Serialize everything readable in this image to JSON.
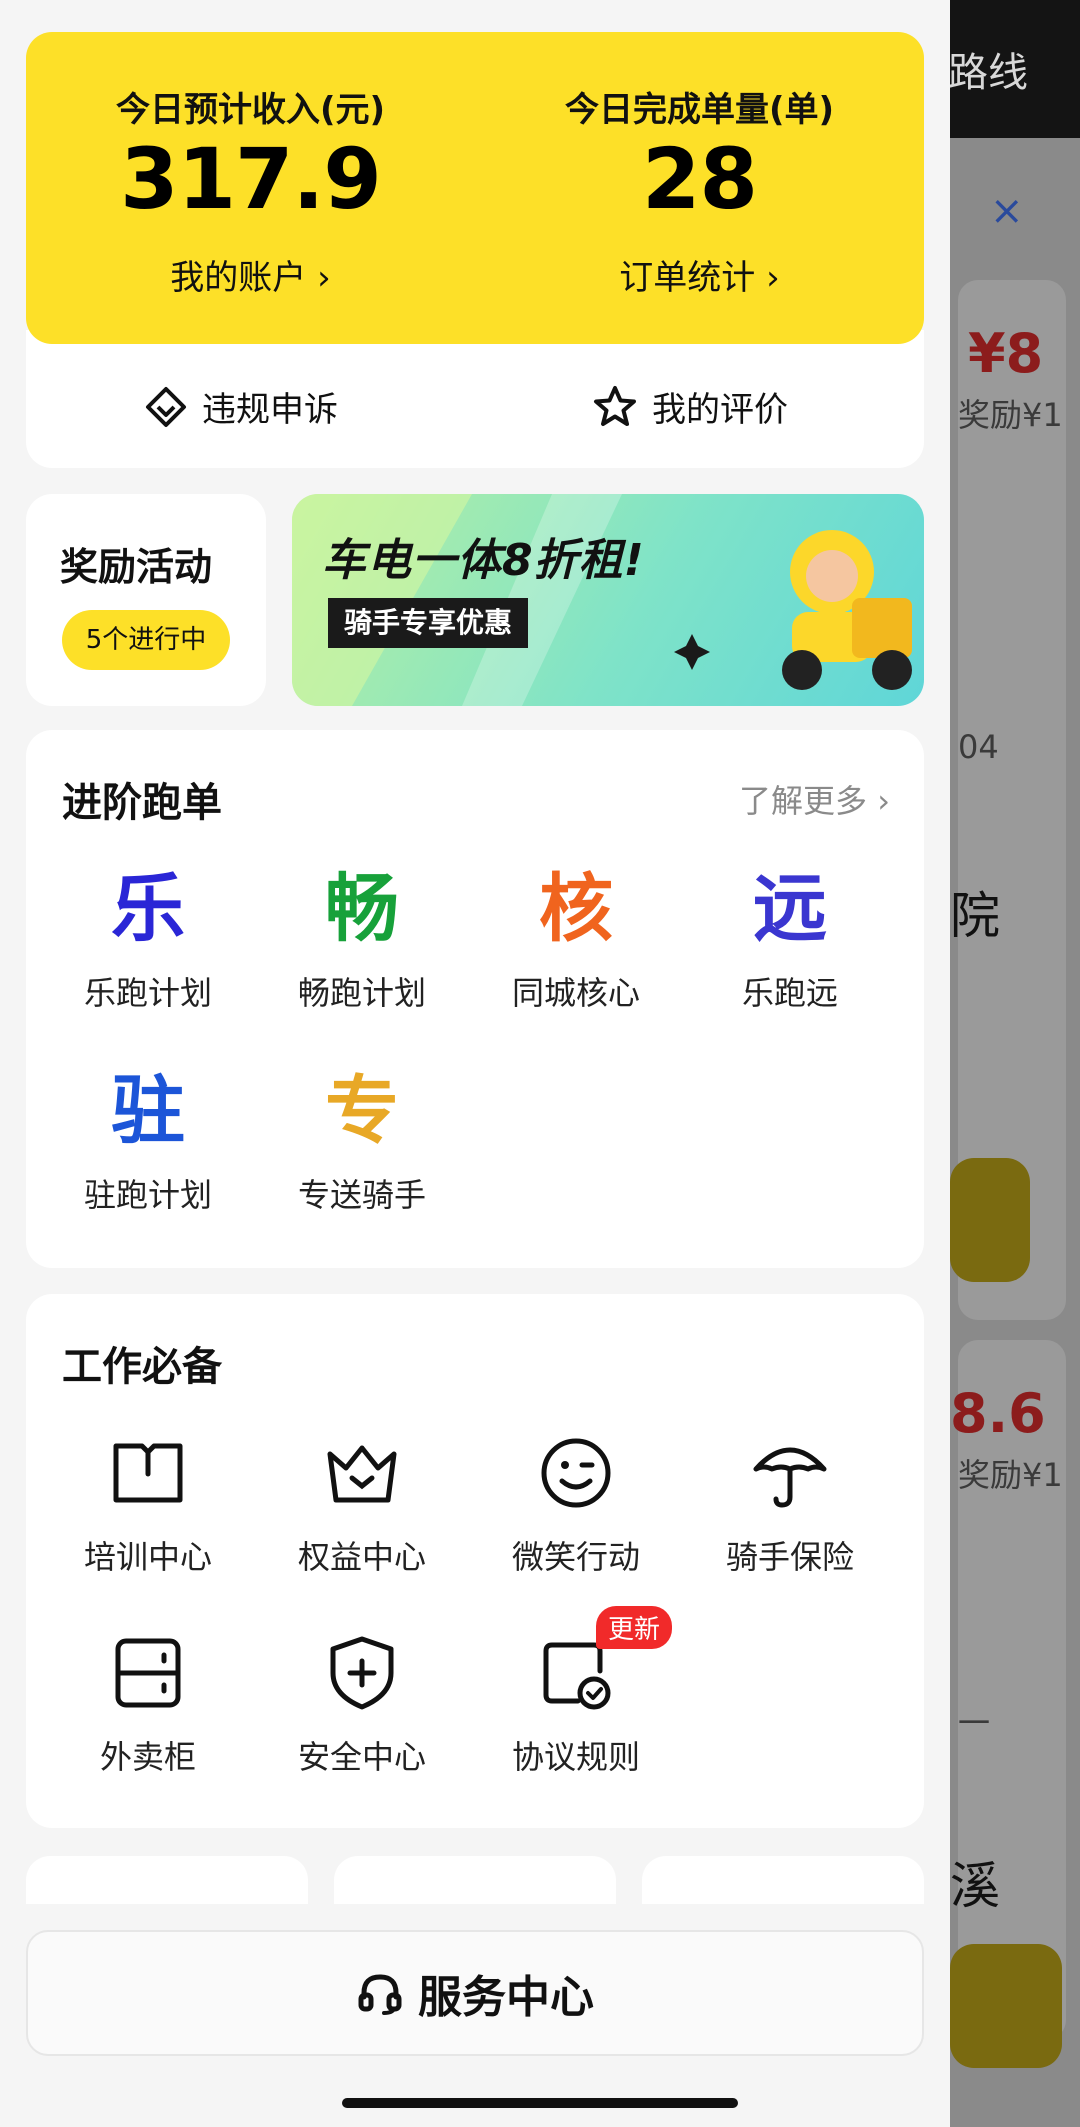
{
  "background": {
    "top_text": "路线",
    "close_glyph": "×",
    "values": [
      "¥8",
      "8.6"
    ],
    "reward_texts": [
      "奖励¥1",
      "奖励¥1"
    ],
    "fragments": [
      "04",
      "院",
      "溪",
      "一"
    ]
  },
  "earnings": {
    "income_label": "今日预计收入(元)",
    "income_value": "317.9",
    "income_link": "我的账户 ›",
    "orders_label": "今日完成单量(单)",
    "orders_value": "28",
    "orders_link": "订单统计 ›",
    "appeal_label": "违规申诉",
    "rating_label": "我的评价"
  },
  "rewards": {
    "title": "奖励活动",
    "pill": "5个进行中"
  },
  "banner": {
    "main": "车电一体8折租!",
    "sub": "骑手专享优惠"
  },
  "advanced": {
    "title": "进阶跑单",
    "more": "了解更多 ›",
    "items": [
      {
        "glyph": "乐",
        "label": "乐跑计划",
        "color": "#2a26d6"
      },
      {
        "glyph": "畅",
        "label": "畅跑计划",
        "color": "#17a13a"
      },
      {
        "glyph": "核",
        "label": "同城核心",
        "color": "#f0641e"
      },
      {
        "glyph": "远",
        "label": "乐跑远",
        "color": "#3a36d0"
      },
      {
        "glyph": "驻",
        "label": "驻跑计划",
        "color": "#1c55d8"
      },
      {
        "glyph": "专",
        "label": "专送骑手",
        "color": "#e8a826"
      }
    ]
  },
  "work": {
    "title": "工作必备",
    "items": [
      {
        "label": "培训中心",
        "icon": "book-icon"
      },
      {
        "label": "权益中心",
        "icon": "crown-icon"
      },
      {
        "label": "微笑行动",
        "icon": "smile-icon"
      },
      {
        "label": "骑手保险",
        "icon": "umbrella-icon"
      },
      {
        "label": "外卖柜",
        "icon": "locker-icon"
      },
      {
        "label": "安全中心",
        "icon": "shield-icon"
      },
      {
        "label": "协议规则",
        "icon": "agreement-icon"
      }
    ],
    "badge": "更新"
  },
  "service": {
    "label": "服务中心"
  }
}
